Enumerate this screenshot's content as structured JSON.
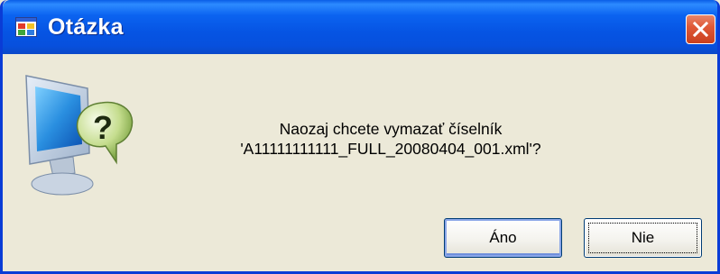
{
  "dialog": {
    "title": "Otázka",
    "app_icon": "window-app-icon",
    "close_icon": "close-icon",
    "question_icon": "monitor-question-icon",
    "message_line1": "Naozaj chcete vymazať číselník",
    "message_line2": "'A11111111111_FULL_20080404_001.xml'?",
    "buttons": {
      "yes_label": "Áno",
      "no_label": "Nie"
    },
    "colors": {
      "titlebar": "#0654e3",
      "close": "#e05a38",
      "face": "#ece9d8"
    }
  }
}
